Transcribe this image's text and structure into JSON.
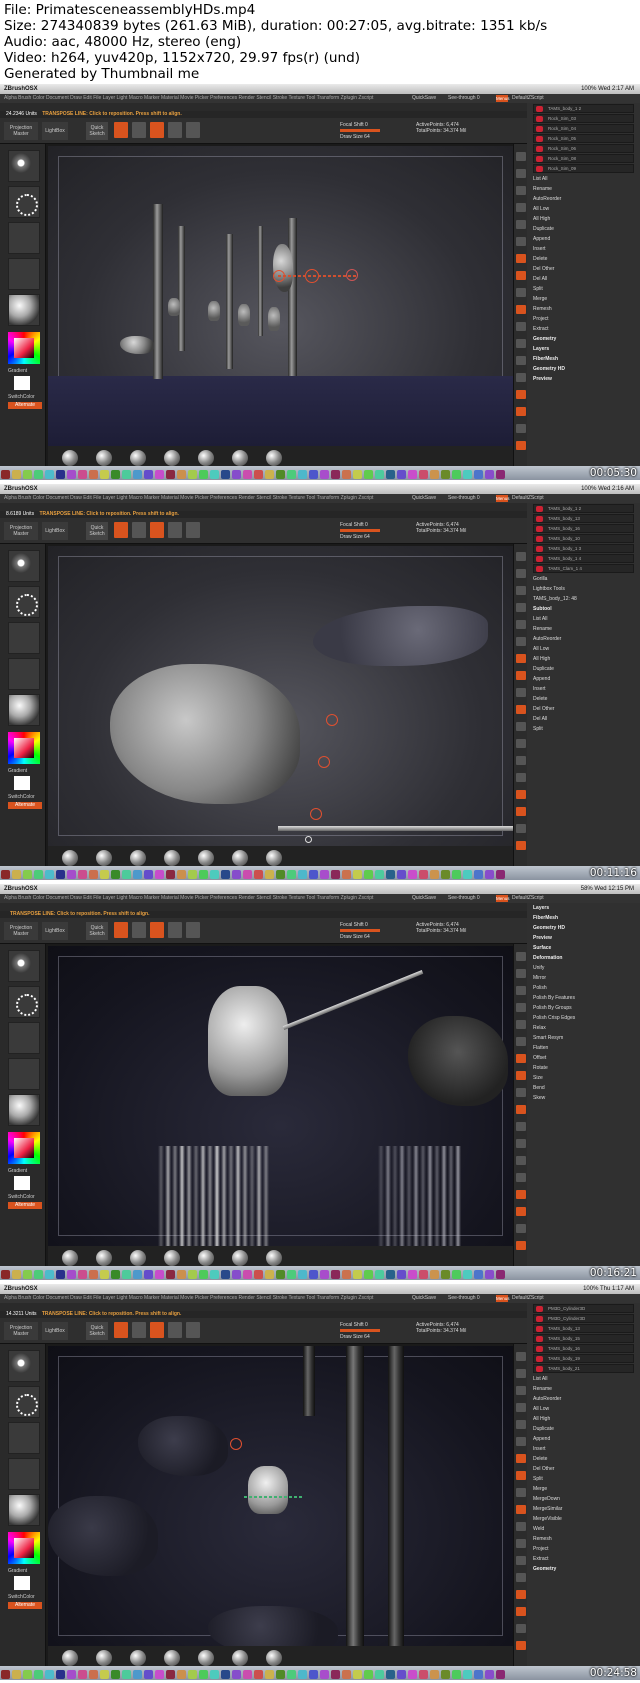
{
  "header": {
    "file": "File: PrimatesceneassemblyHDs.mp4",
    "size": "Size: 274340839 bytes (261.63 MiB), duration: 00:27:05, avg.bitrate: 1351 kb/s",
    "audio": "Audio: aac, 48000 Hz, stereo (eng)",
    "video": "Video: h264, yuv420p, 1152x720, 29.97 fps(r) (und)",
    "generated": "Generated by Thumbnail me"
  },
  "app": {
    "apple": "",
    "name": "ZBrushOSX",
    "menus": "Alpha  Brush  Color  Document  Draw  Edit  File  Layer  Light  Macro  Marker  Material  Movie  Picker  Preferences  Render  Stencil  Stroke  Texture  Tool  Transform  Zplugin  Zscript",
    "quicksave": "QuickSave",
    "seethrough": "See-through 0",
    "menus_btn": "Menus",
    "default_script": "DefaultZScript",
    "projection": "Projection Master",
    "lightbox": "LightBox",
    "quick_sketch": "Quick Sketch",
    "edit": "Edit",
    "draw": "Draw",
    "move": "Move",
    "scale": "Scale",
    "rotate": "Rotate",
    "gradient": "Gradient",
    "switchcolor": "SwitchColor",
    "alternate": "Alternate",
    "focal_shift": "Focal Shift 0",
    "draw_size": "Draw Size 64",
    "active_points": "ActivePoints: 6,474",
    "total_points": "TotalPoints: 34.374 Mil",
    "transpose_hint": "TRANSPOSE LINE: Click to reposition. Press shift to align."
  },
  "bottom_brushes": [
    "SnakeHook",
    "hPolish",
    "Dam_Standard",
    "ClayBuildup",
    "Inflat",
    "ClipCurve",
    "SelectRect"
  ],
  "frames": [
    {
      "menubar_right": "100%  Wed 2:17 AM",
      "units": "24.2346 Units",
      "timestamp": "00:05:30",
      "subtools": [
        "TAMS_body_1 2",
        "Rock_Sim_03",
        "Rock_Sim_04",
        "Rock_Sim_05",
        "Rock_Sim_06",
        "Rock_Sim_08",
        "Rock_Sim_09"
      ],
      "panel_items": [
        "List All",
        "Rename",
        "AutoReorder",
        "All Low",
        "All High",
        "Duplicate",
        "Append",
        "Insert",
        "Delete",
        "Del Other",
        "Del All",
        "Split",
        "Merge",
        "Remesh",
        "Project",
        "Extract",
        "Geometry",
        "Layers",
        "FiberMesh",
        "Geometry HD",
        "Preview"
      ]
    },
    {
      "menubar_right": "100%  Wed 2:16 AM",
      "units": "8.6189 Units",
      "timestamp": "00:11:16",
      "subtools": [
        "TAMS_body_1 2",
        "TAMS_body_13",
        "TAMS_body_16",
        "TAMS_body_10",
        "TAMS_body_1 3",
        "TAMS_body_1 4",
        "TAMS_Clam_1 4"
      ],
      "panel_items": [
        "Gorilla",
        "Lightbox Tools",
        "TAMS_body_12: 48",
        "Subtool",
        "List All",
        "Rename",
        "AutoReorder",
        "All Low",
        "All High",
        "Duplicate",
        "Append",
        "Insert",
        "Delete",
        "Del Other",
        "Del All",
        "Split"
      ]
    },
    {
      "menubar_right": "58%  Wed 12:15 PM",
      "units": "",
      "timestamp": "00:16:21",
      "subtools": [],
      "panel_items": [
        "Layers",
        "FiberMesh",
        "Geometry HD",
        "Preview",
        "Surface",
        "Deformation",
        "Unify",
        "Mirror",
        "Polish",
        "Polish By Features",
        "Polish By Groups",
        "Polish Crisp Edges",
        "Relax",
        "Smart Resym",
        "Flatten",
        "Offset",
        "Rotate",
        "Size",
        "Bend",
        "Skew"
      ]
    },
    {
      "menubar_right": "100%  Thu 1:17 AM",
      "units": "14.3211 Units",
      "timestamp": "00:24:58",
      "subtools": [
        "PM3D_Cylinder3D",
        "PM3D_Cylinder3D",
        "TAMS_body_13",
        "TAMS_body_15",
        "TAMS_body_16",
        "TAMS_body_19",
        "TAMS_body_21"
      ],
      "panel_items": [
        "List All",
        "Rename",
        "AutoReorder",
        "All Low",
        "All High",
        "Duplicate",
        "Append",
        "Insert",
        "Delete",
        "Del Other",
        "Split",
        "Merge",
        "MergeDown",
        "MergeSimilar",
        "MergeVisible",
        "Weld",
        "Remesh",
        "Project",
        "Extract",
        "Geometry"
      ]
    }
  ]
}
